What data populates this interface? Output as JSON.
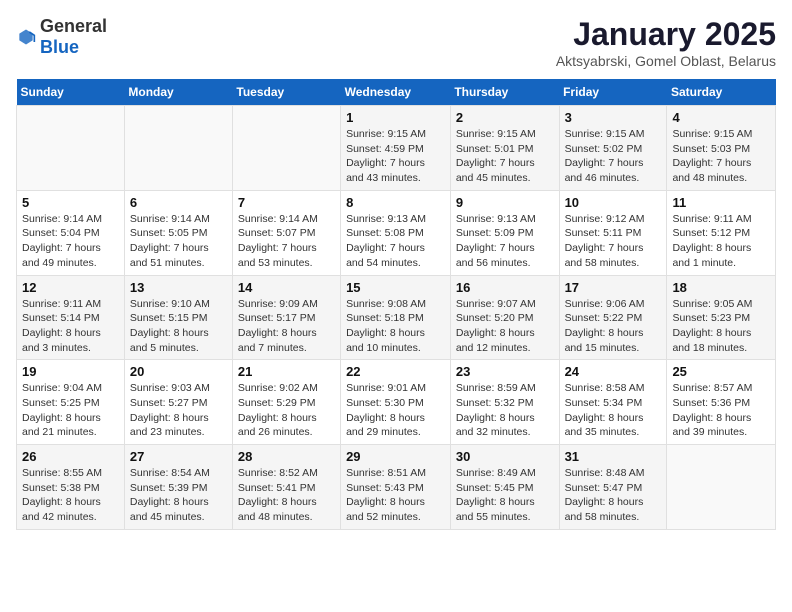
{
  "header": {
    "logo_general": "General",
    "logo_blue": "Blue",
    "title": "January 2025",
    "subtitle": "Aktsyabrski, Gomel Oblast, Belarus"
  },
  "days_of_week": [
    "Sunday",
    "Monday",
    "Tuesday",
    "Wednesday",
    "Thursday",
    "Friday",
    "Saturday"
  ],
  "weeks": [
    [
      {
        "day": "",
        "sunrise": "",
        "sunset": "",
        "daylight": ""
      },
      {
        "day": "",
        "sunrise": "",
        "sunset": "",
        "daylight": ""
      },
      {
        "day": "",
        "sunrise": "",
        "sunset": "",
        "daylight": ""
      },
      {
        "day": "1",
        "sunrise": "Sunrise: 9:15 AM",
        "sunset": "Sunset: 4:59 PM",
        "daylight": "Daylight: 7 hours and 43 minutes."
      },
      {
        "day": "2",
        "sunrise": "Sunrise: 9:15 AM",
        "sunset": "Sunset: 5:01 PM",
        "daylight": "Daylight: 7 hours and 45 minutes."
      },
      {
        "day": "3",
        "sunrise": "Sunrise: 9:15 AM",
        "sunset": "Sunset: 5:02 PM",
        "daylight": "Daylight: 7 hours and 46 minutes."
      },
      {
        "day": "4",
        "sunrise": "Sunrise: 9:15 AM",
        "sunset": "Sunset: 5:03 PM",
        "daylight": "Daylight: 7 hours and 48 minutes."
      }
    ],
    [
      {
        "day": "5",
        "sunrise": "Sunrise: 9:14 AM",
        "sunset": "Sunset: 5:04 PM",
        "daylight": "Daylight: 7 hours and 49 minutes."
      },
      {
        "day": "6",
        "sunrise": "Sunrise: 9:14 AM",
        "sunset": "Sunset: 5:05 PM",
        "daylight": "Daylight: 7 hours and 51 minutes."
      },
      {
        "day": "7",
        "sunrise": "Sunrise: 9:14 AM",
        "sunset": "Sunset: 5:07 PM",
        "daylight": "Daylight: 7 hours and 53 minutes."
      },
      {
        "day": "8",
        "sunrise": "Sunrise: 9:13 AM",
        "sunset": "Sunset: 5:08 PM",
        "daylight": "Daylight: 7 hours and 54 minutes."
      },
      {
        "day": "9",
        "sunrise": "Sunrise: 9:13 AM",
        "sunset": "Sunset: 5:09 PM",
        "daylight": "Daylight: 7 hours and 56 minutes."
      },
      {
        "day": "10",
        "sunrise": "Sunrise: 9:12 AM",
        "sunset": "Sunset: 5:11 PM",
        "daylight": "Daylight: 7 hours and 58 minutes."
      },
      {
        "day": "11",
        "sunrise": "Sunrise: 9:11 AM",
        "sunset": "Sunset: 5:12 PM",
        "daylight": "Daylight: 8 hours and 1 minute."
      }
    ],
    [
      {
        "day": "12",
        "sunrise": "Sunrise: 9:11 AM",
        "sunset": "Sunset: 5:14 PM",
        "daylight": "Daylight: 8 hours and 3 minutes."
      },
      {
        "day": "13",
        "sunrise": "Sunrise: 9:10 AM",
        "sunset": "Sunset: 5:15 PM",
        "daylight": "Daylight: 8 hours and 5 minutes."
      },
      {
        "day": "14",
        "sunrise": "Sunrise: 9:09 AM",
        "sunset": "Sunset: 5:17 PM",
        "daylight": "Daylight: 8 hours and 7 minutes."
      },
      {
        "day": "15",
        "sunrise": "Sunrise: 9:08 AM",
        "sunset": "Sunset: 5:18 PM",
        "daylight": "Daylight: 8 hours and 10 minutes."
      },
      {
        "day": "16",
        "sunrise": "Sunrise: 9:07 AM",
        "sunset": "Sunset: 5:20 PM",
        "daylight": "Daylight: 8 hours and 12 minutes."
      },
      {
        "day": "17",
        "sunrise": "Sunrise: 9:06 AM",
        "sunset": "Sunset: 5:22 PM",
        "daylight": "Daylight: 8 hours and 15 minutes."
      },
      {
        "day": "18",
        "sunrise": "Sunrise: 9:05 AM",
        "sunset": "Sunset: 5:23 PM",
        "daylight": "Daylight: 8 hours and 18 minutes."
      }
    ],
    [
      {
        "day": "19",
        "sunrise": "Sunrise: 9:04 AM",
        "sunset": "Sunset: 5:25 PM",
        "daylight": "Daylight: 8 hours and 21 minutes."
      },
      {
        "day": "20",
        "sunrise": "Sunrise: 9:03 AM",
        "sunset": "Sunset: 5:27 PM",
        "daylight": "Daylight: 8 hours and 23 minutes."
      },
      {
        "day": "21",
        "sunrise": "Sunrise: 9:02 AM",
        "sunset": "Sunset: 5:29 PM",
        "daylight": "Daylight: 8 hours and 26 minutes."
      },
      {
        "day": "22",
        "sunrise": "Sunrise: 9:01 AM",
        "sunset": "Sunset: 5:30 PM",
        "daylight": "Daylight: 8 hours and 29 minutes."
      },
      {
        "day": "23",
        "sunrise": "Sunrise: 8:59 AM",
        "sunset": "Sunset: 5:32 PM",
        "daylight": "Daylight: 8 hours and 32 minutes."
      },
      {
        "day": "24",
        "sunrise": "Sunrise: 8:58 AM",
        "sunset": "Sunset: 5:34 PM",
        "daylight": "Daylight: 8 hours and 35 minutes."
      },
      {
        "day": "25",
        "sunrise": "Sunrise: 8:57 AM",
        "sunset": "Sunset: 5:36 PM",
        "daylight": "Daylight: 8 hours and 39 minutes."
      }
    ],
    [
      {
        "day": "26",
        "sunrise": "Sunrise: 8:55 AM",
        "sunset": "Sunset: 5:38 PM",
        "daylight": "Daylight: 8 hours and 42 minutes."
      },
      {
        "day": "27",
        "sunrise": "Sunrise: 8:54 AM",
        "sunset": "Sunset: 5:39 PM",
        "daylight": "Daylight: 8 hours and 45 minutes."
      },
      {
        "day": "28",
        "sunrise": "Sunrise: 8:52 AM",
        "sunset": "Sunset: 5:41 PM",
        "daylight": "Daylight: 8 hours and 48 minutes."
      },
      {
        "day": "29",
        "sunrise": "Sunrise: 8:51 AM",
        "sunset": "Sunset: 5:43 PM",
        "daylight": "Daylight: 8 hours and 52 minutes."
      },
      {
        "day": "30",
        "sunrise": "Sunrise: 8:49 AM",
        "sunset": "Sunset: 5:45 PM",
        "daylight": "Daylight: 8 hours and 55 minutes."
      },
      {
        "day": "31",
        "sunrise": "Sunrise: 8:48 AM",
        "sunset": "Sunset: 5:47 PM",
        "daylight": "Daylight: 8 hours and 58 minutes."
      },
      {
        "day": "",
        "sunrise": "",
        "sunset": "",
        "daylight": ""
      }
    ]
  ]
}
